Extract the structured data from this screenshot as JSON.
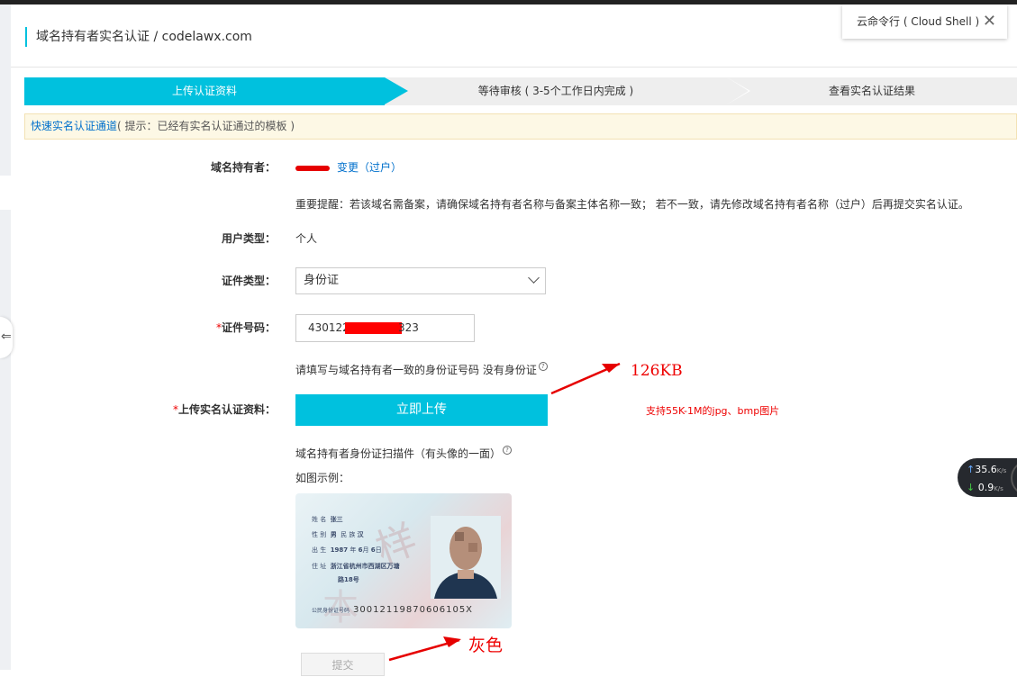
{
  "header": {
    "title": "域名持有者实名认证 / codelawx.com"
  },
  "cloud_shell": {
    "label": "云命令行 ( Cloud Shell )",
    "close_icon": "close-icon"
  },
  "steps": [
    {
      "label": "上传认证资料",
      "active": true
    },
    {
      "label": "等待审核 ( 3-5个工作日内完成 )",
      "active": false
    },
    {
      "label": "查看实名认证结果",
      "active": false
    }
  ],
  "tip": {
    "link": "快速实名认证通道",
    "hint": "( 提示：已经有实名认证通过的模板 )"
  },
  "form": {
    "holder_label": "域名持有者：",
    "holder_change": "变更（过户）",
    "notice": "重要提醒：若该域名需备案，请确保域名持有者名称与备案主体名称一致； 若不一致，请先修改域名持有者名称（过户）后再提交实名认证。",
    "user_type_label": "用户类型：",
    "user_type_value": "个人",
    "cert_type_label": "证件类型：",
    "cert_type_value": "身份证",
    "cert_no_label": "证件号码：",
    "cert_no_prefix": "430122",
    "cert_no_suffix": "323",
    "cert_no_help": "请填写与域名持有者一致的身份证号码 没有身份证",
    "upload_label": "上传实名认证资料：",
    "upload_button": "立即上传",
    "scan_note": "域名持有者身份证扫描件（有头像的一面）",
    "example_label": "如图示例：",
    "submit_button": "提交"
  },
  "id_card_sample": {
    "name_key": "姓 名",
    "name_value": "张三",
    "gender_key": "性 别",
    "gender_value": "男",
    "ethnic_key": "民 族",
    "ethnic_value": "汉",
    "birth_key": "出 生",
    "birth_year": "1987",
    "birth_year_unit": "年",
    "birth_month": "6",
    "birth_month_unit": "月",
    "birth_day": "6",
    "birth_day_unit": "日",
    "address_key": "住 址",
    "address_value_1": "浙江省杭州市西湖区万塘",
    "address_value_2": "路18号",
    "number_key": "公民身份证号码",
    "number_value": "30012119870606105X"
  },
  "annotations": {
    "size": "126KB",
    "support": "支持55K-1M的jpg、bmp图片",
    "grey": "灰色"
  },
  "speed_widget": {
    "up": "35.6",
    "down": "0.9",
    "unit": "K/s"
  },
  "colors": {
    "accent": "#00c1de",
    "annotation": "#e60000",
    "link": "#0070cc"
  }
}
